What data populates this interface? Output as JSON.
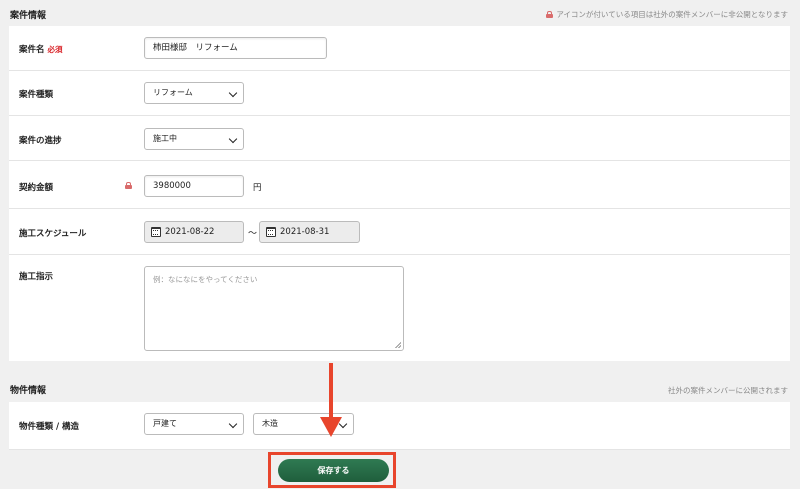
{
  "case_section": {
    "title": "案件情報",
    "note": "アイコンが付いている項目は社外の案件メンバーに非公開となります"
  },
  "fields": {
    "name": {
      "label": "案件名",
      "required": "必須",
      "value": "柿田様邸　リフォーム"
    },
    "type": {
      "label": "案件種類",
      "value": "リフォーム"
    },
    "progress": {
      "label": "案件の進捗",
      "value": "施工中"
    },
    "amount": {
      "label": "契約金額",
      "value": "3980000",
      "unit": "円"
    },
    "schedule": {
      "label": "施工スケジュール",
      "start": "2021-08-22",
      "separator": "〜",
      "end": "2021-08-31"
    },
    "instructions": {
      "label": "施工指示",
      "placeholder": "例：なになにをやってください"
    }
  },
  "property_section": {
    "title": "物件情報",
    "note": "社外の案件メンバーに公開されます"
  },
  "property": {
    "label": "物件種類 / 構造",
    "kind": "戸建て",
    "structure": "木造"
  },
  "save_label": "保存する",
  "colors": {
    "accent": "#e8452c",
    "save": "#27694a",
    "required": "#d9262b"
  }
}
